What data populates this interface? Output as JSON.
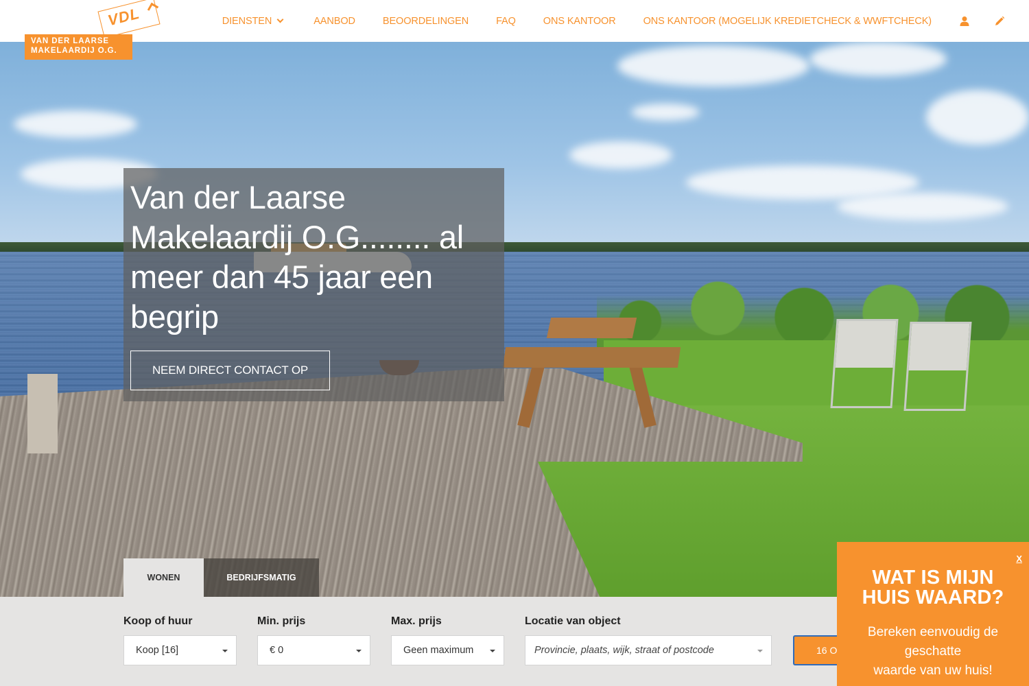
{
  "brand": {
    "logo_mark": "VDL",
    "logo_line1": "VAN DER LAARSE",
    "logo_line2": "MAKELAARDIJ O.G.",
    "accent_color": "#f7922e"
  },
  "nav": {
    "items": [
      {
        "label": "DIENSTEN",
        "has_dropdown": true
      },
      {
        "label": "AANBOD"
      },
      {
        "label": "BEOORDELINGEN"
      },
      {
        "label": "FAQ"
      },
      {
        "label": "ONS KANTOOR"
      },
      {
        "label": "ONS KANTOOR (MOGELIJK KREDIETCHECK & WWFTCHECK)"
      }
    ],
    "icons": [
      "user-icon",
      "pencil-icon"
    ]
  },
  "hero": {
    "title": "Van der Laarse Makelaardij O.G........ al meer dan 45 jaar een begrip",
    "cta_label": "NEEM DIRECT CONTACT OP"
  },
  "search": {
    "tabs": [
      {
        "label": "WONEN",
        "active": true
      },
      {
        "label": "BEDRIJFSMATIG",
        "active": false
      }
    ],
    "fields": {
      "type": {
        "label": "Koop of huur",
        "value": "Koop [16]"
      },
      "min_price": {
        "label": "Min. prijs",
        "value": "€ 0"
      },
      "max_price": {
        "label": "Max. prijs",
        "value": "Geen maximum"
      },
      "location": {
        "label": "Locatie van object",
        "placeholder": "Provincie, plaats, wijk, straat of postcode"
      }
    },
    "submit_label": "16 O"
  },
  "popup": {
    "close_label": "X",
    "title": "WAT IS MIJN HUIS WAARD?",
    "text_line1": "Bereken eenvoudig de geschatte",
    "text_line2": "waarde van uw huis!"
  }
}
